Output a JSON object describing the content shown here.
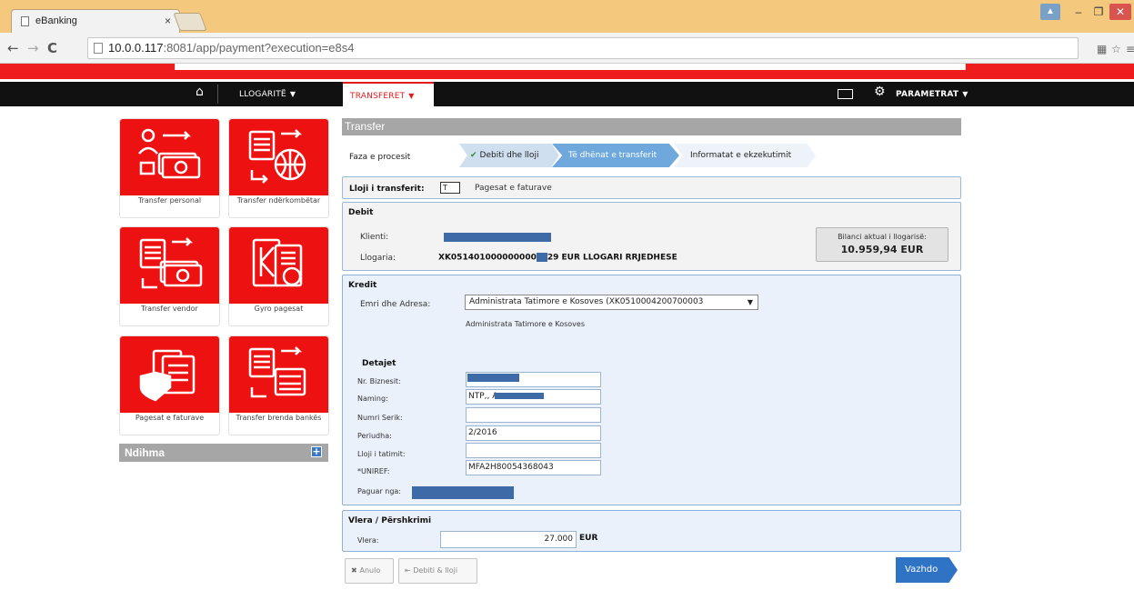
{
  "browser": {
    "tab_title": "eBanking",
    "tab_close": "×",
    "url_host": "10.0.0.117",
    "url_rest": ":8081/app/payment?execution=e8s4"
  },
  "nav": {
    "llogarite": "LLOGARITË",
    "transferet": "TRANSFERET",
    "parametrat": "PARAMETRAT"
  },
  "sidebar": {
    "tiles": [
      {
        "label": "Transfer personal",
        "icon": "transfer-personal-icon"
      },
      {
        "label": "Transfer ndërkombëtar",
        "icon": "transfer-international-icon"
      },
      {
        "label": "Transfer vendor",
        "icon": "transfer-local-icon"
      },
      {
        "label": "Gyro pagesat",
        "icon": "gyro-payments-icon"
      },
      {
        "label": "Pagesat e faturave",
        "icon": "bill-payments-icon"
      },
      {
        "label": "Transfer brenda bankës",
        "icon": "internal-transfer-icon"
      }
    ],
    "help": "Ndihma"
  },
  "form": {
    "header": "Transfer",
    "faza_label": "Faza e procesit",
    "steps": [
      "Debiti dhe lloji",
      "Të dhënat e transferit",
      "Informatat e ekzekutimit"
    ],
    "lloji_label": "Lloji i transferit:",
    "lloji_value": "Pagesat e faturave",
    "debit": {
      "title": "Debit",
      "klienti_label": "Klienti:",
      "llogaria_label": "Llogaria:",
      "llogaria_value_a": "XK051401000000000",
      "llogaria_value_b": "29 EUR LLOGARI RRJEDHESE",
      "balance_label": "Bilanci aktual i llogarisë:",
      "balance_value": "10.959,94 EUR"
    },
    "kredit": {
      "title": "Kredit",
      "emri_label": "Emri dhe Adresa:",
      "emri_value": "Administrata Tatimore e Kosoves (XK0510004200700003",
      "emri_sub": "Administrata Tatimore e Kosoves",
      "detajet": "Detajet",
      "fields": [
        {
          "label": "Nr. Biznesit:",
          "value": ""
        },
        {
          "label": "Naming:",
          "value": "NTP,, Am"
        },
        {
          "label": "Numri Serik:",
          "value": ""
        },
        {
          "label": "Periudha:",
          "value": "2/2016"
        },
        {
          "label": "Lloji i tatimit:",
          "value": ""
        },
        {
          "label": "*UNIREF:",
          "value": "MFA2H80054368043"
        }
      ],
      "paguar_label": "Paguar nga:"
    },
    "vlera": {
      "title": "Vlera / Përshkrimi",
      "label": "Vlera:",
      "value": "27.000",
      "currency": "EUR"
    },
    "buttons": {
      "anulo": "Anulo",
      "back": "Debiti & lloji",
      "next": "Vazhdo"
    }
  }
}
